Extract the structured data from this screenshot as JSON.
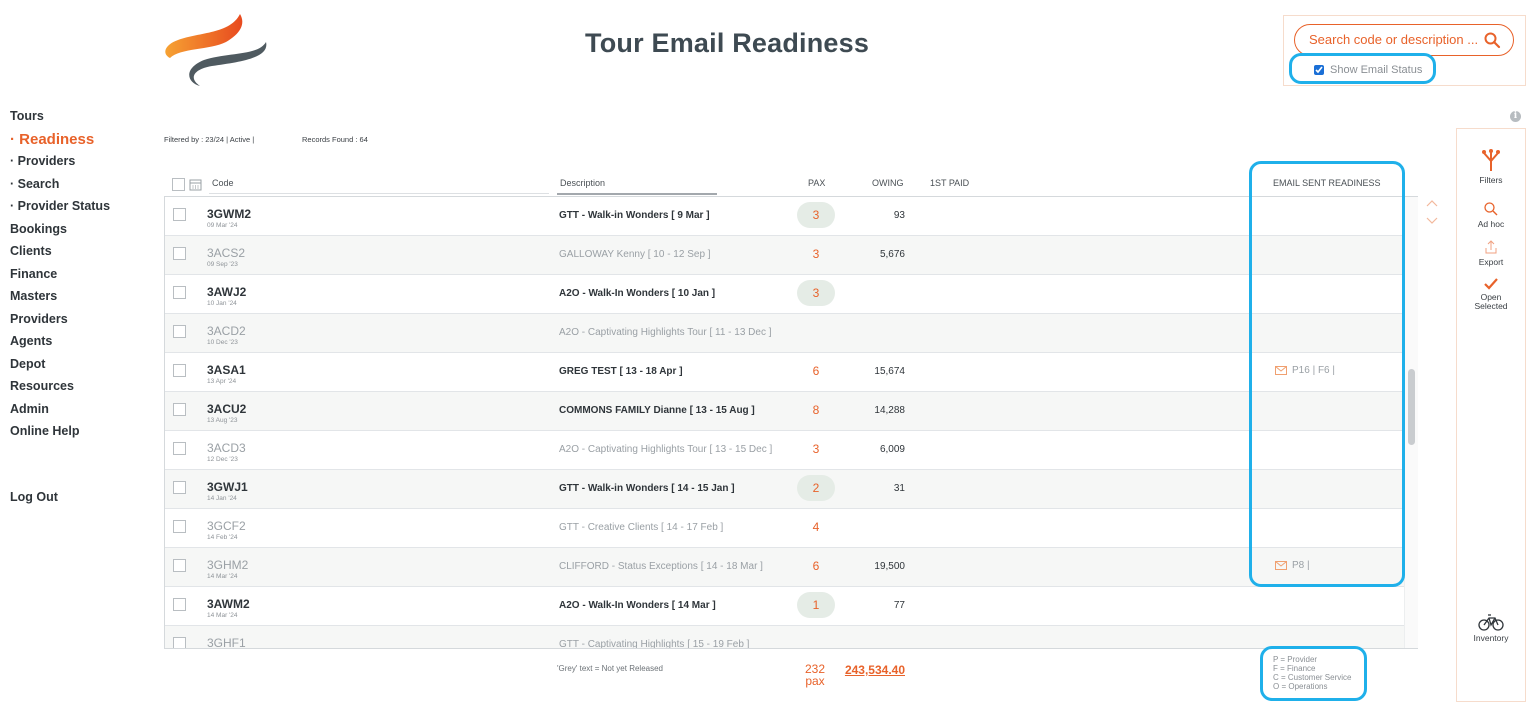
{
  "page": {
    "title": "Tour Email Readiness"
  },
  "search": {
    "placeholder": "Search code or description ...",
    "show_email_status_label": "Show Email Status",
    "show_email_status_checked": true
  },
  "sidebar": {
    "items": [
      {
        "label": "Tours",
        "active": false,
        "sub": false
      },
      {
        "label": "· Readiness",
        "active": true,
        "sub": true
      },
      {
        "label": "· Providers",
        "active": false,
        "sub": true
      },
      {
        "label": "· Search",
        "active": false,
        "sub": true
      },
      {
        "label": "· Provider Status",
        "active": false,
        "sub": true
      },
      {
        "label": "Bookings",
        "active": false,
        "sub": false
      },
      {
        "label": "Clients",
        "active": false,
        "sub": false
      },
      {
        "label": "Finance",
        "active": false,
        "sub": false
      },
      {
        "label": "Masters",
        "active": false,
        "sub": false
      },
      {
        "label": "Providers",
        "active": false,
        "sub": false
      },
      {
        "label": "Agents",
        "active": false,
        "sub": false
      },
      {
        "label": "Depot",
        "active": false,
        "sub": false
      },
      {
        "label": "Resources",
        "active": false,
        "sub": false
      },
      {
        "label": "Admin",
        "active": false,
        "sub": false
      },
      {
        "label": "Online Help",
        "active": false,
        "sub": false
      }
    ],
    "logout": "Log Out"
  },
  "filter": {
    "filtered_by": "Filtered by : 23/24 | Active |",
    "records_found": "Records Found : 64"
  },
  "table": {
    "headers": {
      "code": "Code",
      "description": "Description",
      "pax": "PAX",
      "owing": "OWING",
      "first_paid": "1ST PAID",
      "email_sent_readiness": "EMAIL SENT READINESS"
    },
    "rows": [
      {
        "code": "3GWM2",
        "date": "09 Mar '24",
        "description": "GTT - Walk-in Wonders  [ 9 Mar ]",
        "pax": "3",
        "pax_pill": true,
        "owing": "93",
        "grey": false,
        "email": ""
      },
      {
        "code": "3ACS2",
        "date": "09 Sep '23",
        "description": "GALLOWAY Kenny  [ 10 - 12 Sep ]",
        "pax": "3",
        "pax_pill": false,
        "owing": "5,676",
        "grey": true,
        "email": ""
      },
      {
        "code": "3AWJ2",
        "date": "10 Jan '24",
        "description": "A2O - Walk-In Wonders  [ 10 Jan ]",
        "pax": "3",
        "pax_pill": true,
        "owing": "",
        "grey": false,
        "email": ""
      },
      {
        "code": "3ACD2",
        "date": "10 Dec '23",
        "description": "A2O - Captivating Highlights Tour  [ 11 - 13 Dec ]",
        "pax": "",
        "pax_pill": false,
        "owing": "",
        "grey": true,
        "email": ""
      },
      {
        "code": "3ASA1",
        "date": "13 Apr '24",
        "description": "GREG TEST  [ 13 - 18 Apr ]",
        "pax": "6",
        "pax_pill": false,
        "owing": "15,674",
        "grey": false,
        "email": "P16  |  F6  |"
      },
      {
        "code": "3ACU2",
        "date": "13 Aug '23",
        "description": "COMMONS FAMILY Dianne  [ 13 - 15 Aug ]",
        "pax": "8",
        "pax_pill": false,
        "owing": "14,288",
        "grey": false,
        "email": ""
      },
      {
        "code": "3ACD3",
        "date": "12 Dec '23",
        "description": "A2O - Captivating Highlights Tour  [ 13 - 15 Dec ]",
        "pax": "3",
        "pax_pill": false,
        "owing": "6,009",
        "grey": true,
        "email": ""
      },
      {
        "code": "3GWJ1",
        "date": "14 Jan '24",
        "description": "GTT - Walk-in Wonders  [ 14 - 15 Jan ]",
        "pax": "2",
        "pax_pill": true,
        "owing": "31",
        "grey": false,
        "email": ""
      },
      {
        "code": "3GCF2",
        "date": "14 Feb '24",
        "description": "GTT - Creative Clients  [ 14 - 17 Feb ]",
        "pax": "4",
        "pax_pill": false,
        "owing": "",
        "grey": true,
        "email": ""
      },
      {
        "code": "3GHM2",
        "date": "14 Mar '24",
        "description": "CLIFFORD - Status Exceptions  [ 14 - 18 Mar ]",
        "pax": "6",
        "pax_pill": false,
        "owing": "19,500",
        "grey": true,
        "email": "P8  |"
      },
      {
        "code": "3AWM2",
        "date": "14 Mar '24",
        "description": "A2O - Walk-In Wonders  [ 14 Mar ]",
        "pax": "1",
        "pax_pill": true,
        "owing": "77",
        "grey": false,
        "email": ""
      },
      {
        "code": "3GHF1",
        "date": "",
        "description": "GTT - Captivating Highlights  [ 15 - 19 Feb ]",
        "pax": "",
        "pax_pill": false,
        "owing": "",
        "grey": true,
        "email": ""
      }
    ]
  },
  "footer": {
    "grey_note": "'Grey' text = Not yet Released",
    "total_pax": "232",
    "total_pax_unit": "pax",
    "total_owing": "243,534.40",
    "legend": [
      "P = Provider",
      "F = Finance",
      "C = Customer Service",
      "O = Operations"
    ]
  },
  "tools": [
    {
      "label": "Filters",
      "icon": "filters-icon"
    },
    {
      "label": "Ad hoc",
      "icon": "search-icon"
    },
    {
      "label": "Export",
      "icon": "export-icon"
    },
    {
      "label": "Open\nSelected",
      "icon": "check-icon"
    },
    {
      "label": "Inventory",
      "icon": "bicycle-icon"
    }
  ],
  "colors": {
    "accent": "#e8622a",
    "highlight": "#1fb0ea",
    "text_dark": "#2f353a",
    "text_grey": "#9aa0a5"
  }
}
